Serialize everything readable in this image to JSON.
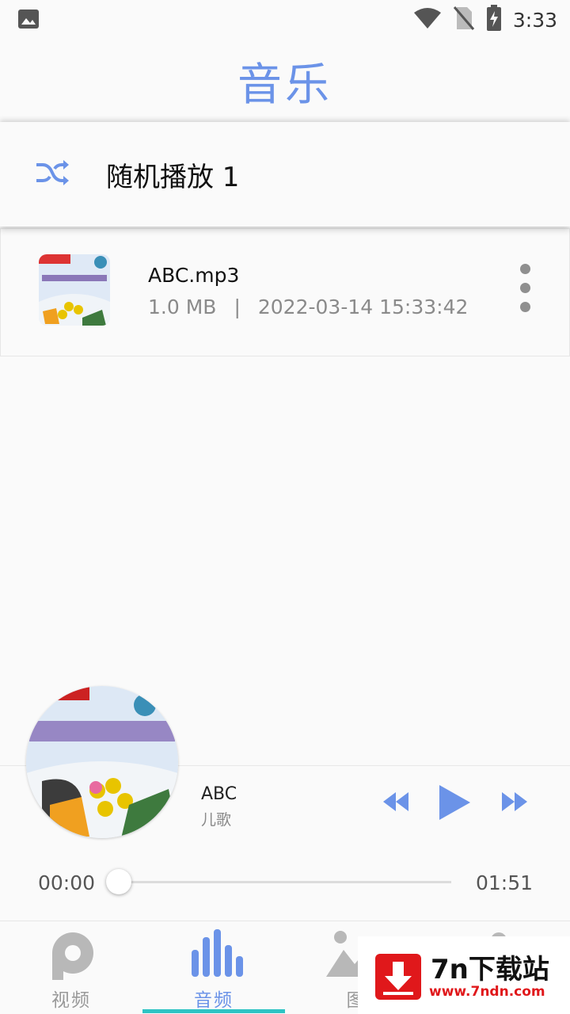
{
  "status_bar": {
    "time": "3:33",
    "icons": [
      "gallery-icon",
      "wifi-icon",
      "no-sim-icon",
      "battery-charging-icon"
    ]
  },
  "header": {
    "title": "音乐"
  },
  "shuffle": {
    "label": "随机播放 1",
    "icon": "shuffle-icon"
  },
  "songs": [
    {
      "title": "ABC.mp3",
      "size": "1.0 MB",
      "separator": "|",
      "date": "2022-03-14 15:33:42"
    }
  ],
  "player": {
    "title": "ABC",
    "artist": "儿歌",
    "current_time": "00:00",
    "total_time": "01:51",
    "progress": 0
  },
  "nav": {
    "items": [
      {
        "label": "视频",
        "icon": "video-p-icon"
      },
      {
        "label": "音频",
        "icon": "audio-bars-icon",
        "active": true
      },
      {
        "label": "图",
        "icon": "image-icon"
      },
      {
        "label": "",
        "icon": "more-icon"
      }
    ]
  },
  "watermark": {
    "title": "7n下载站",
    "url": "www.7ndn.com"
  },
  "colors": {
    "accent": "#6b93e8",
    "underline": "#2ec4c4",
    "watermark_red": "#e0181b"
  }
}
